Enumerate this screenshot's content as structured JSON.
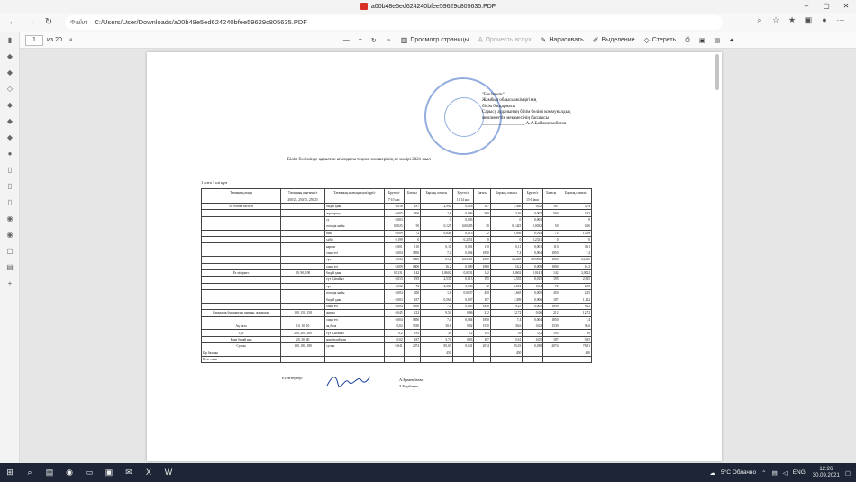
{
  "window": {
    "title": "a00b48e5ed624240bfee59629c805635.PDF",
    "minimize": "–",
    "maximize": "▢",
    "close": "✕"
  },
  "address": {
    "info_label": "Файл",
    "url": "C:/Users/User/Downloads/a00b48e5ed624240bfee59629c805635.PDF"
  },
  "pdf_toolbar": {
    "page_current": "1",
    "page_total": "из 20",
    "minus": "—",
    "plus": "+",
    "view_label": "Просмотр страницы",
    "read_aloud_label": "Прочесть вслух",
    "draw_label": "Нарисовать",
    "highlight_label": "Выделение",
    "erase_label": "Стереть"
  },
  "document": {
    "approve_lines": [
      "\"Бекітемін\"",
      "Жамбыл облысы әкімдігінің",
      "білім басқармасы",
      "Сарысу ауданының білім бөлімі коммуналдық",
      "мемлекеттік мекемесінің басшысы",
      "___________________ А.А.Байманғамбетов"
    ],
    "title": "Білім бөлімінде қаралған ағымдағы тоқсан мөлшерінің ас мәзірі 2021 жыл",
    "date_label": "1 апта 1 ші күн",
    "headers": [
      "Тағамның атауы",
      "Тағамның шығымы/г",
      "Тағамның шығындалуы/тұрі/г",
      "Брутто/г",
      "Бағасы",
      "Барлық сомасы",
      "Брутто/г",
      "Бағасы",
      "Барлық сомасы",
      "Брутто/г",
      "Бағасы",
      "Барлық сомасы"
    ],
    "subheaders": [
      "",
      "200/25, 250/25, 250/25",
      "",
      "7-10 жас",
      "",
      "",
      "11-14 жас",
      "",
      "",
      "15-18жас",
      "",
      ""
    ],
    "rows": [
      [
        "Үй есепке кеспесі",
        "",
        "бидай ұны",
        "0,016",
        "187",
        "2,992",
        "0,018",
        "187",
        "3,366",
        "0,02",
        "187",
        "3,74"
      ],
      [
        "",
        "",
        "жұмыртқа",
        "0,005",
        "560",
        "2,8",
        "0,006",
        "560",
        "3,36",
        "0,007",
        "560",
        "3,92"
      ],
      [
        "",
        "",
        "су",
        "0,003",
        "",
        "0",
        "0,003",
        "",
        "0",
        "0,003",
        "",
        "0"
      ],
      [
        "",
        "",
        "өсімдік майы",
        "0,0025",
        "50",
        "0,125",
        "0,00285",
        "50",
        "0,1425",
        "0,0032",
        "50",
        "0,16"
      ],
      [
        "",
        "",
        "пияз",
        "0,009",
        "72",
        "0,648",
        "0,013",
        "72",
        "0,936",
        "0,014",
        "72",
        "1,008"
      ],
      [
        "",
        "",
        "сәбіз",
        "0,199",
        "0",
        "0",
        "0,2151",
        "0",
        "0",
        "0,2331",
        "0",
        "0"
      ],
      [
        "",
        "",
        "картоп",
        "0,001",
        "110",
        "0,11",
        "0,001",
        "110",
        "0,11",
        "0,001",
        "110",
        "0,11"
      ],
      [
        "",
        "",
        "сиыр еті",
        "0,004",
        "1850",
        "7,4",
        "0,004",
        "1850",
        "7,4",
        "0,004",
        "1850",
        "7,4"
      ],
      [
        "",
        "",
        "тұз",
        "0,034",
        "1800",
        "61,2",
        "0,03481",
        "1800",
        "62,658",
        "0,03592",
        "1800",
        "64,656"
      ],
      [
        "",
        "",
        "сиыр еті",
        "0,009",
        "1800",
        "16,2",
        "0,009",
        "1800",
        "16,2",
        "0,009",
        "1800",
        "16,2"
      ],
      [
        "Ет пісірмес",
        "80, 90, 100",
        "бидай ұны",
        "0,0131",
        "142",
        "1,8602",
        "0,0131",
        "142",
        "1,8602",
        "0,0141",
        "142",
        "2,0022"
      ],
      [
        "",
        "",
        "сүт 3,2пайыз",
        "0,013",
        "195",
        "2,535",
        "0,013",
        "195",
        "2,535",
        "0,015",
        "195",
        "2,925"
      ],
      [
        "",
        "",
        "тұз",
        "0,032",
        "72",
        "2,304",
        "0,036",
        "72",
        "2,592",
        "0,04",
        "72",
        "2,88"
      ],
      [
        "",
        "",
        "өсімдік майы",
        "0,004",
        "450",
        "1,8",
        "0,0037",
        "450",
        "1,665",
        "0,005",
        "450",
        "2,25"
      ],
      [
        "",
        "",
        "бидай ұны",
        "0,003",
        "187",
        "0,561",
        "0,007",
        "187",
        "1,309",
        "0,006",
        "187",
        "1,122"
      ],
      [
        "",
        "",
        "сиыр еті",
        "0,004",
        "1850",
        "7,4",
        "0,005",
        "1850",
        "9,25",
        "0,005",
        "1850",
        "9,25"
      ],
      [
        "Сарымсақ бұршақтың шырын, жармадан",
        "100, 150, 150",
        "жарма",
        "0,045",
        "212",
        "9,54",
        "0,06",
        "212",
        "12,72",
        "0,06",
        "212",
        "12,72"
      ],
      [
        "",
        "",
        "сиыр еті",
        "0,004",
        "1850",
        "7,4",
        "0,004",
        "1850",
        "7,4",
        "0,004",
        "1850",
        "7,4"
      ],
      [
        "Ақ бала",
        "10, 10, 10",
        "ақ бала",
        "0,02",
        "1530",
        "30,6",
        "0,02",
        "1530",
        "30,6",
        "0,02",
        "1530",
        "30,6"
      ],
      [
        "Сүт",
        "200, 200, 200",
        "сүт 3,2пайыз",
        "0,2",
        "195",
        "39",
        "0,2",
        "195",
        "39",
        "0,2",
        "195",
        "39"
      ],
      [
        "Қара бидай нан",
        "20, 30, 40",
        "нан бидай нан",
        "0,02",
        "187",
        "3,74",
        "0,03",
        "187",
        "5,61",
        "0,05",
        "187",
        "9,35"
      ],
      [
        "Сусын",
        "180, 180, 180",
        "сусын",
        "0,041",
        "2074",
        "85,03",
        "0,041",
        "2074",
        "85,03",
        "0,038",
        "2074",
        "78,81"
      ]
    ],
    "total_label": "Бір баланы",
    "total_count": "1",
    "total_1": "450",
    "total_2": "450",
    "total_3": "450",
    "footer_label": "Келе сойы",
    "signers_label": "Есептеулер:",
    "names": [
      "А.Ермекбаева",
      "З.Ерубаева"
    ]
  },
  "tray": {
    "weather": "5°C Облачно",
    "lang": "ENG",
    "time": "12:26",
    "date": "30.09.2021"
  }
}
